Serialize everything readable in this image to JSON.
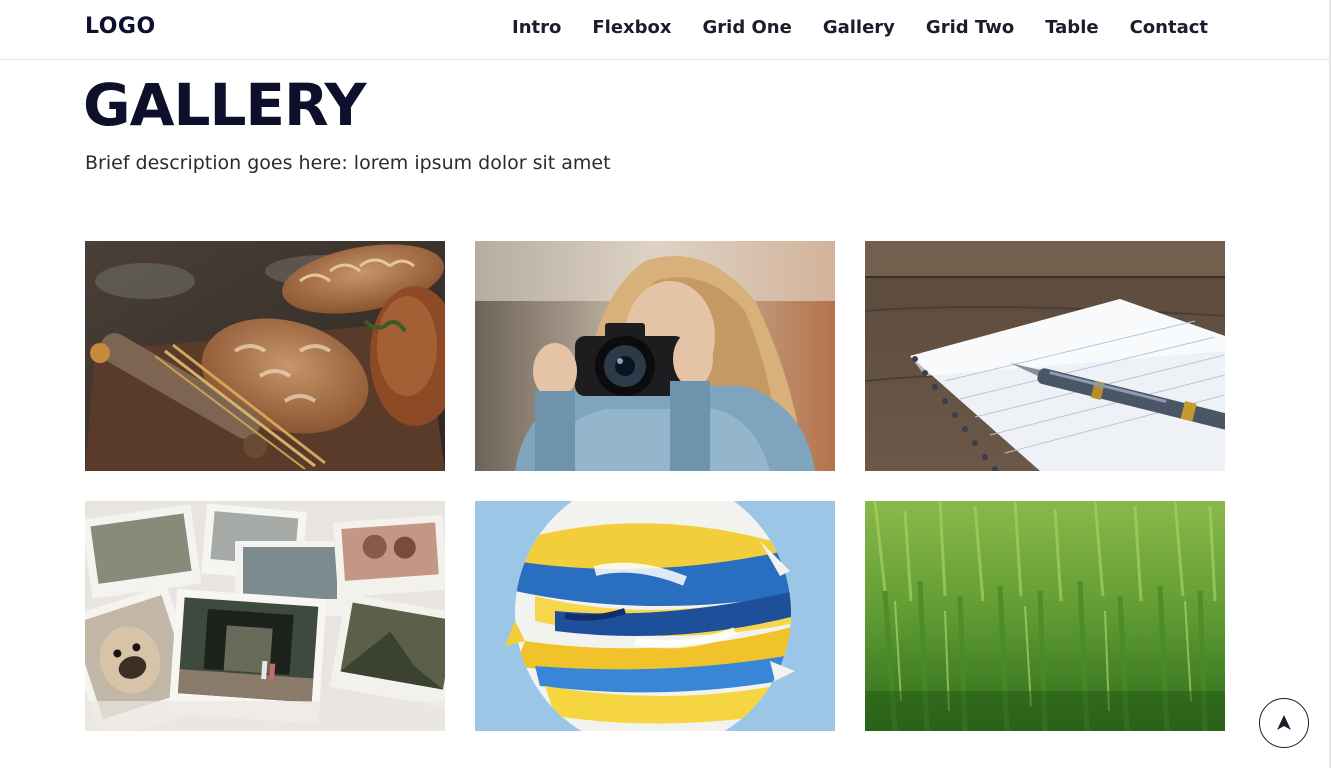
{
  "header": {
    "logo": "LOGO",
    "nav": [
      {
        "label": "Intro"
      },
      {
        "label": "Flexbox"
      },
      {
        "label": "Grid One"
      },
      {
        "label": "Gallery"
      },
      {
        "label": "Grid Two"
      },
      {
        "label": "Table"
      },
      {
        "label": "Contact"
      }
    ]
  },
  "main": {
    "title": "GALLERY",
    "description": "Brief description goes here: lorem ipsum dolor sit amet"
  },
  "gallery": {
    "images": [
      {
        "subject": "bread-loaves-with-rolling-pin-and-wheat"
      },
      {
        "subject": "woman-holding-camera"
      },
      {
        "subject": "notebook-and-fountain-pen-on-wood"
      },
      {
        "subject": "scattered-polaroid-photos"
      },
      {
        "subject": "blue-yellow-paint-sphere"
      },
      {
        "subject": "green-grass-field"
      }
    ]
  },
  "back_to_top": {
    "icon": "arrow-up-icon"
  },
  "colors": {
    "heading": "#0d0f2b",
    "nav_text": "#1c1c2a",
    "divider": "#e3e3e3"
  }
}
